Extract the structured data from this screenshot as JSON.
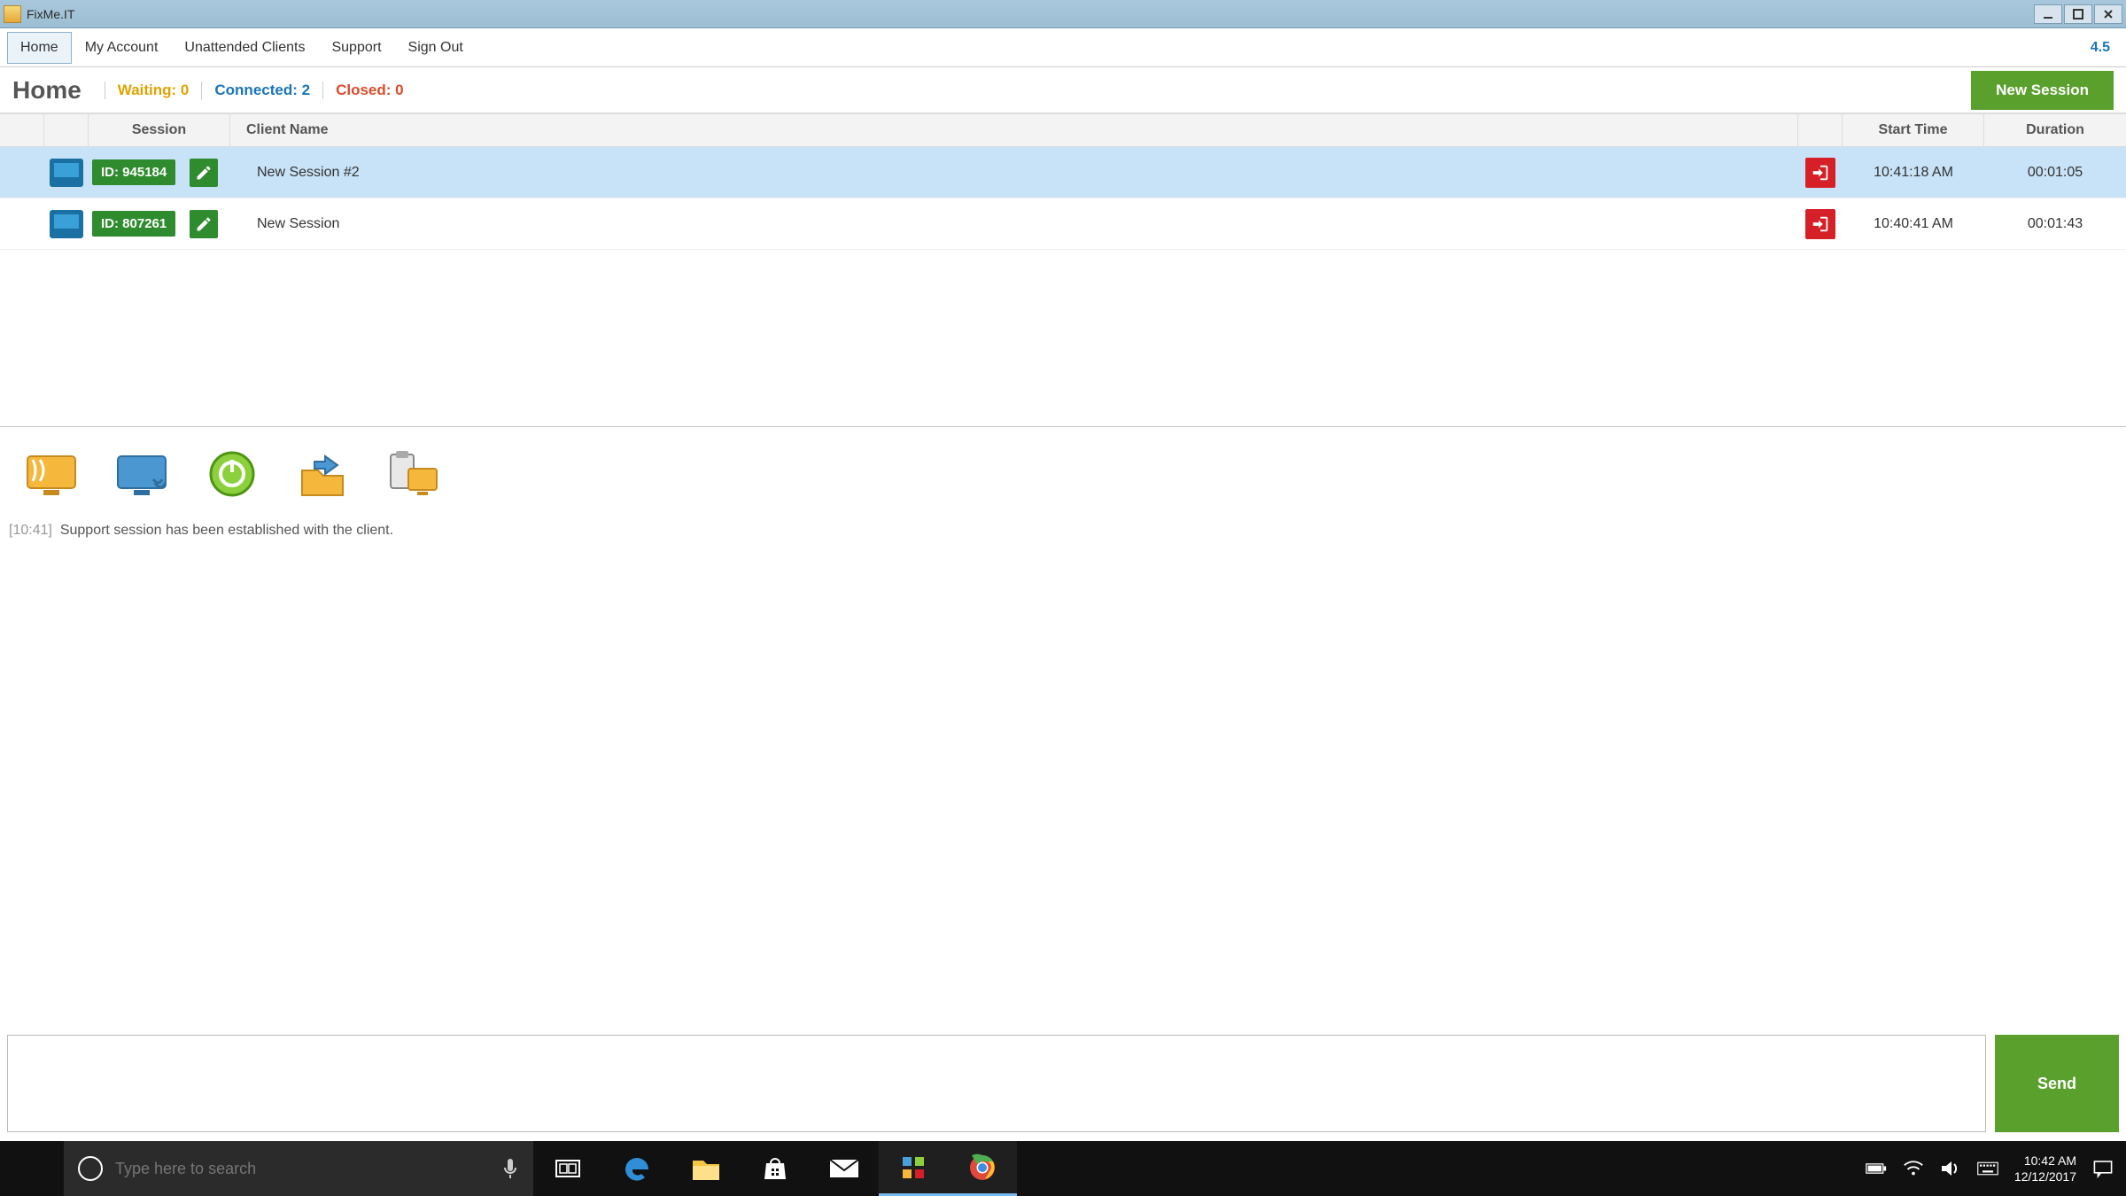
{
  "window": {
    "title": "FixMe.IT"
  },
  "nav": {
    "items": [
      "Home",
      "My Account",
      "Unattended Clients",
      "Support",
      "Sign Out"
    ],
    "active_index": 0,
    "version": "4.5"
  },
  "status": {
    "page_title": "Home",
    "waiting_label": "Waiting: 0",
    "connected_label": "Connected: 2",
    "closed_label": "Closed: 0",
    "new_session_button": "New Session"
  },
  "table": {
    "headers": {
      "session": "Session",
      "client_name": "Client Name",
      "start_time": "Start Time",
      "duration": "Duration"
    },
    "rows": [
      {
        "id": "ID: 945184",
        "name": "New Session #2",
        "start": "10:41:18 AM",
        "duration": "00:01:05",
        "selected": true
      },
      {
        "id": "ID: 807261",
        "name": "New Session",
        "start": "10:40:41 AM",
        "duration": "00:01:43",
        "selected": false
      }
    ]
  },
  "tools": {
    "icons": [
      "remote-control-icon",
      "view-desktop-icon",
      "reboot-icon",
      "file-transfer-icon",
      "clipboard-icon"
    ]
  },
  "chat": {
    "log": [
      {
        "time": "[10:41]",
        "text": "Support session has been established with the client."
      }
    ],
    "input_value": "",
    "send_label": "Send"
  },
  "taskbar": {
    "search_placeholder": "Type here to search",
    "clock_time": "10:42 AM",
    "clock_date": "12/12/2017"
  }
}
